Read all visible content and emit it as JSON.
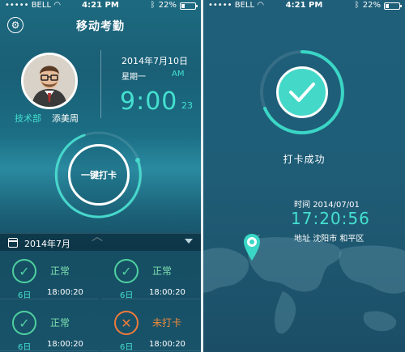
{
  "status_bar": {
    "carrier": "BELL",
    "time": "4:21 PM",
    "battery": "22%"
  },
  "left": {
    "title": "移动考勤",
    "icons": {
      "settings": "gear-icon"
    },
    "user": {
      "department": "技术部",
      "name": "添美周"
    },
    "date": "2014年7月10日",
    "weekday": "星期一",
    "ampm": "AM",
    "clock": "9:00",
    "seconds": "23",
    "punch_label": "一键打卡",
    "month": "2014年7月",
    "records": [
      {
        "status": "正常",
        "day": "6日",
        "time": "18:00:20",
        "ok": true
      },
      {
        "status": "正常",
        "day": "6日",
        "time": "18:00:20",
        "ok": true
      },
      {
        "status": "正常",
        "day": "6日",
        "time": "18:00:20",
        "ok": true
      },
      {
        "status": "未打卡",
        "day": "6日",
        "time": "18:00:20",
        "ok": false
      }
    ],
    "colors": {
      "accent": "#44e0d0",
      "ok": "#4fd1a0",
      "miss": "#f07a3a"
    }
  },
  "right": {
    "success": "打卡成功",
    "time_label": "时间",
    "date": "2014/07/01",
    "time": "17:20:56",
    "address_label": "地址",
    "address": "沈阳市 和平区"
  }
}
